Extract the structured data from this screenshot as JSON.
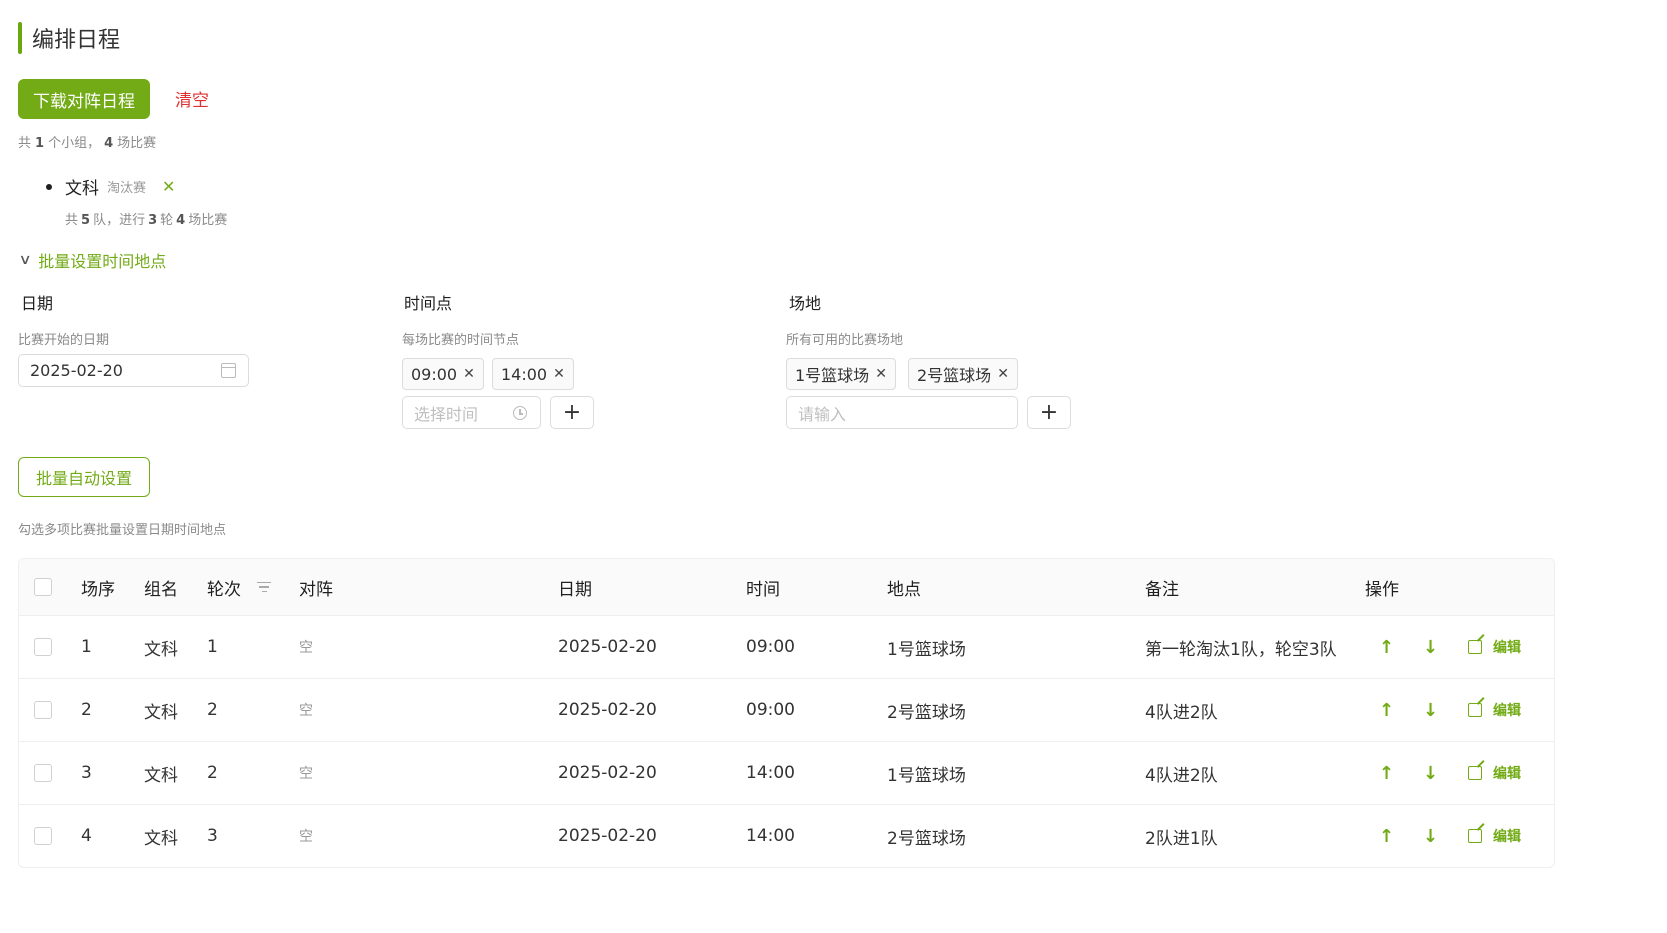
{
  "page_title": "编排日程",
  "toolbar": {
    "download_label": "下载对阵日程",
    "clear_label": "清空"
  },
  "summary": {
    "prefix": "共",
    "group_count": "1",
    "mid": "个小组，",
    "match_count": "4",
    "suffix": "场比赛"
  },
  "group": {
    "name": "文科",
    "type": "淘汰赛",
    "remove_glyph": "✕",
    "stats": {
      "p1": "共",
      "teams": "5",
      "p2": "队，进行",
      "rounds": "3",
      "p3": "轮",
      "matches": "4",
      "p4": "场比赛"
    }
  },
  "batch": {
    "header": "批量设置时间地点",
    "date": {
      "label": "日期",
      "hint": "比赛开始的日期",
      "value": "2025-02-20"
    },
    "time": {
      "label": "时间点",
      "hint": "每场比赛的时间节点",
      "tags": [
        "09:00",
        "14:00"
      ],
      "placeholder": "选择时间"
    },
    "venue": {
      "label": "场地",
      "hint": "所有可用的比赛场地",
      "tags": [
        "1号篮球场",
        "2号篮球场"
      ],
      "placeholder": "请输入"
    },
    "plus_glyph": "+",
    "auto_label": "批量自动设置",
    "auto_hint": "勾选多项比赛批量设置日期时间地点"
  },
  "table": {
    "columns": [
      "场序",
      "组名",
      "轮次",
      "对阵",
      "日期",
      "时间",
      "地点",
      "备注",
      "操作"
    ],
    "action_up": "↑",
    "action_down": "↓",
    "action_edit": "编辑",
    "rows": [
      {
        "seq": "1",
        "group": "文科",
        "round": "1",
        "match": "空",
        "date": "2025-02-20",
        "time": "09:00",
        "venue": "1号篮球场",
        "note": "第一轮淘汰1队，轮空3队"
      },
      {
        "seq": "2",
        "group": "文科",
        "round": "2",
        "match": "空",
        "date": "2025-02-20",
        "time": "09:00",
        "venue": "2号篮球场",
        "note": "4队进2队"
      },
      {
        "seq": "3",
        "group": "文科",
        "round": "2",
        "match": "空",
        "date": "2025-02-20",
        "time": "14:00",
        "venue": "1号篮球场",
        "note": "4队进2队"
      },
      {
        "seq": "4",
        "group": "文科",
        "round": "3",
        "match": "空",
        "date": "2025-02-20",
        "time": "14:00",
        "venue": "2号篮球场",
        "note": "2队进1队"
      }
    ]
  },
  "colors": {
    "accent": "#72ab16",
    "danger": "#e0302f",
    "muted": "#8a8a8a"
  }
}
